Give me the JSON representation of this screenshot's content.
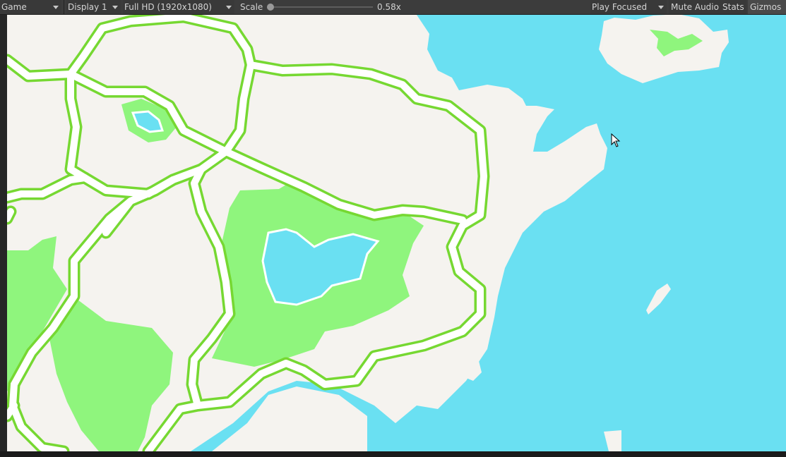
{
  "toolbar": {
    "view_label": "Game",
    "display_label": "Display 1",
    "resolution_label": "Full HD (1920x1080)",
    "scale_label": "Scale",
    "scale_value": "0.58x",
    "scale_fraction": 0.0,
    "play_mode_label": "Play Focused",
    "mute_label": "Mute Audio",
    "stats_label": "Stats",
    "gizmos_label": "Gizmos"
  },
  "map": {
    "colors": {
      "land": "#f5f3ef",
      "water": "#6ae0f2",
      "grass": "#8ff57d",
      "road_edge": "#76d832",
      "road_fill": "#ffffff"
    }
  }
}
